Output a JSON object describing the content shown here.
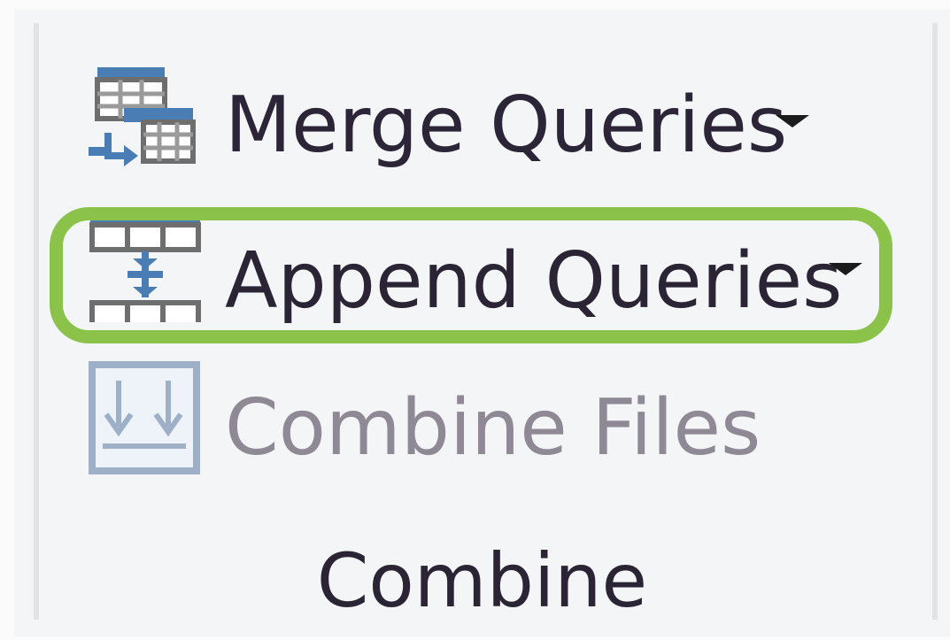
{
  "group": {
    "label": "Combine",
    "commands": [
      {
        "label": "Merge Queries",
        "icon": "merge-queries-icon",
        "has_dropdown": true,
        "enabled": true
      },
      {
        "label": "Append Queries",
        "icon": "append-queries-icon",
        "has_dropdown": true,
        "enabled": true,
        "highlighted": true
      },
      {
        "label": "Combine Files",
        "icon": "combine-files-icon",
        "has_dropdown": false,
        "enabled": false
      }
    ]
  },
  "colors": {
    "highlight": "#8bc34a",
    "icon_blue": "#4a7db4",
    "icon_gray": "#6e6e6e",
    "disabled_text": "#8f8895",
    "text": "#2a2434"
  }
}
